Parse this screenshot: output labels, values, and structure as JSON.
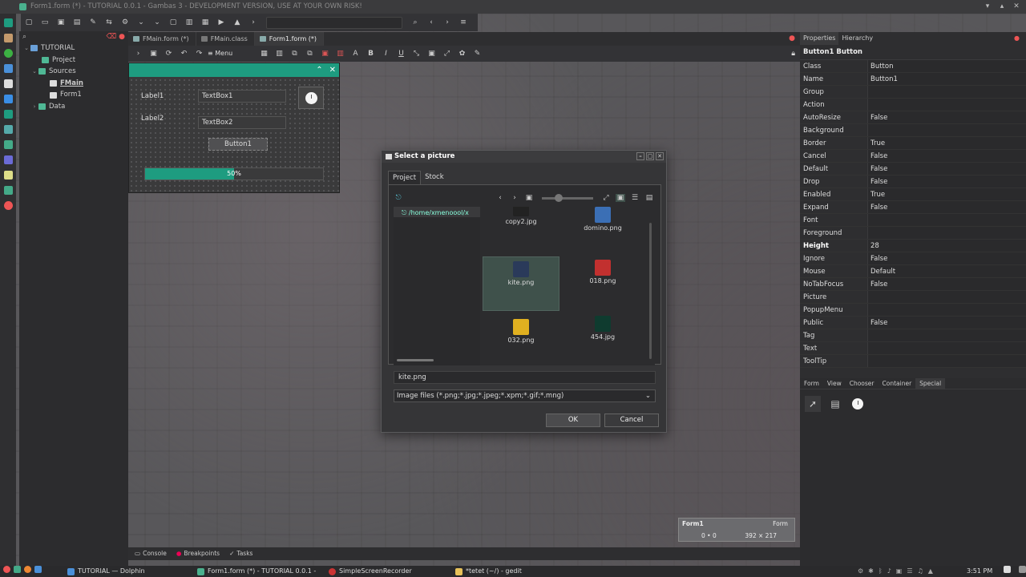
{
  "window": {
    "title": "Form1.form (*) - TUTORIAL 0.0.1 - Gambas 3 - DEVELOPMENT VERSION, USE AT YOUR OWN RISK!"
  },
  "project_tree": {
    "items": [
      {
        "label": "TUTORIAL"
      },
      {
        "label": "Project"
      },
      {
        "label": "Sources"
      },
      {
        "label": "FMain"
      },
      {
        "label": "Form1"
      },
      {
        "label": "Data"
      }
    ]
  },
  "editor_tabs": [
    "FMain.form (*)",
    "FMain.class",
    "Form1.form (*)"
  ],
  "form_toolbar": {
    "menu_editor": "Menu editor..."
  },
  "designer": {
    "label1": "Label1",
    "label2": "Label2",
    "textbox1": "TextBox1",
    "textbox2": "TextBox2",
    "button1": "Button1",
    "progress_text": "50%",
    "progress_value": 0.5
  },
  "properties": {
    "tab_properties": "Properties",
    "tab_hierarchy": "Hierarchy",
    "title": "Button1 Button",
    "rows": [
      {
        "name": "Class",
        "value": "Button"
      },
      {
        "name": "Name",
        "value": "Button1"
      },
      {
        "name": "Group",
        "value": ""
      },
      {
        "name": "Action",
        "value": ""
      },
      {
        "name": "AutoResize",
        "value": "False"
      },
      {
        "name": "Background",
        "value": ""
      },
      {
        "name": "Border",
        "value": "True"
      },
      {
        "name": "Cancel",
        "value": "False"
      },
      {
        "name": "Default",
        "value": "False"
      },
      {
        "name": "Drop",
        "value": "False"
      },
      {
        "name": "Enabled",
        "value": "True"
      },
      {
        "name": "Expand",
        "value": "False"
      },
      {
        "name": "Font",
        "value": ""
      },
      {
        "name": "Foreground",
        "value": ""
      },
      {
        "name": "Height",
        "value": "28"
      },
      {
        "name": "Ignore",
        "value": "False"
      },
      {
        "name": "Mouse",
        "value": "Default"
      },
      {
        "name": "NoTabFocus",
        "value": "False"
      },
      {
        "name": "Picture",
        "value": ""
      },
      {
        "name": "PopupMenu",
        "value": ""
      },
      {
        "name": "Public",
        "value": "False"
      },
      {
        "name": "Tag",
        "value": ""
      },
      {
        "name": "Text",
        "value": ""
      },
      {
        "name": "ToolTip",
        "value": ""
      }
    ]
  },
  "palette": {
    "tabs": [
      "Form",
      "View",
      "Chooser",
      "Container",
      "Special"
    ]
  },
  "bottom_tabs": [
    "Console",
    "Breakpoints",
    "Tasks"
  ],
  "form_status": {
    "name": "Form1",
    "type": "Form",
    "position": "0 • 0",
    "size": "392 × 217"
  },
  "dialog": {
    "title": "Select a picture",
    "tabs": [
      "Project",
      "Stock"
    ],
    "path": "/home/xmenoool/x",
    "files": [
      {
        "name": "copy2.jpg",
        "color": "#222"
      },
      {
        "name": "domino.png",
        "color": "#3b6fb5"
      },
      {
        "name": "kite.png",
        "color": "#2a3a5a"
      },
      {
        "name": "018.png",
        "color": "#c2302f"
      },
      {
        "name": "032.png",
        "color": "#e0b020"
      },
      {
        "name": "454.jpg",
        "color": "#0f3b2f"
      }
    ],
    "filename": "kite.png",
    "filter": "Image files (*.png;*.jpg;*.jpeg;*.xpm;*.gif;*.mng)",
    "ok": "OK",
    "cancel": "Cancel"
  },
  "taskbar": {
    "items": [
      "TUTORIAL — Dolphin",
      "Form1.form (*) - TUTORIAL 0.0.1 -",
      "SimpleScreenRecorder",
      "*tetet (~/) - gedit"
    ],
    "clock": "3:51 PM"
  },
  "colors": {
    "accent": "#1e9c80"
  }
}
